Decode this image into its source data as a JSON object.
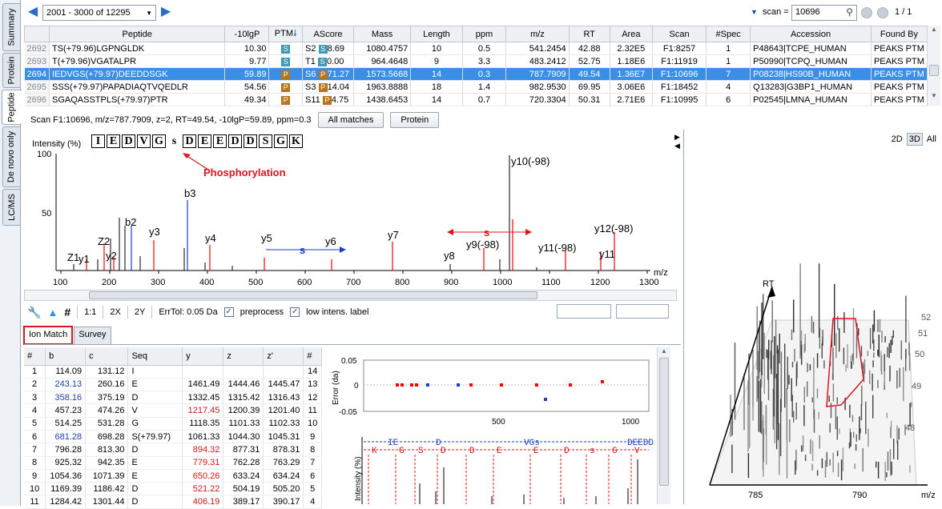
{
  "side_tabs": [
    "Summary",
    "Protein",
    "Peptide",
    "De novo only",
    "LC/MS"
  ],
  "nav": {
    "range": "2001 - 3000 of 12295",
    "scan_label": "scan =",
    "scan_value": "10696",
    "page": "1 / 1"
  },
  "peptide_table": {
    "headers": [
      "Peptide",
      "-10lgP",
      "PTM",
      "AScore",
      "Mass",
      "Length",
      "ppm",
      "m/z",
      "RT",
      "Area",
      "Scan",
      "#Spec",
      "Accession",
      "Found By"
    ],
    "rows": [
      {
        "num": "2692",
        "peptide": "TS(+79.96)LGPNGLDK",
        "lgp": "10.30",
        "ptm": "S",
        "ascore_site": "S2",
        "ascore_badge": "S",
        "ascore": "8.69",
        "mass": "1080.4757",
        "length": "10",
        "ppm": "0.5",
        "mz": "541.2454",
        "rt": "42.88",
        "area": "2.32E5",
        "scan": "F1:8257",
        "spec": "1",
        "accession": "P48643|TCPE_HUMAN",
        "found": "PEAKS PTM"
      },
      {
        "num": "2693",
        "peptide": "T(+79.96)VGATALPR",
        "lgp": "9.77",
        "ptm": "S",
        "ascore_site": "T1",
        "ascore_badge": "S",
        "ascore": "0.00",
        "mass": "964.4648",
        "length": "9",
        "ppm": "3.3",
        "mz": "483.2412",
        "rt": "52.75",
        "area": "1.18E6",
        "scan": "F1:11919",
        "spec": "1",
        "accession": "P50990|TCPQ_HUMAN",
        "found": "PEAKS PTM"
      },
      {
        "num": "2694",
        "peptide": "IEDVGS(+79.97)DEEDDSGK",
        "lgp": "59.89",
        "ptm": "P",
        "ascore_site": "S6",
        "ascore_badge": "P",
        "ascore": "71.27",
        "mass": "1573.5668",
        "length": "14",
        "ppm": "0.3",
        "mz": "787.7909",
        "rt": "49.54",
        "area": "1.36E7",
        "scan": "F1:10696",
        "spec": "7",
        "accession": "P08238|HS90B_HUMAN",
        "found": "PEAKS PTM"
      },
      {
        "num": "2695",
        "peptide": "SSS(+79.97)PAPADIAQTVQEDLR",
        "lgp": "54.56",
        "ptm": "P",
        "ascore_site": "S3",
        "ascore_badge": "P",
        "ascore": "14.04",
        "mass": "1963.8888",
        "length": "18",
        "ppm": "1.4",
        "mz": "982.9530",
        "rt": "69.95",
        "area": "3.06E6",
        "scan": "F1:18452",
        "spec": "4",
        "accession": "Q13283|G3BP1_HUMAN",
        "found": "PEAKS PTM"
      },
      {
        "num": "2696",
        "peptide": "SGAQASSTPLS(+79.97)PTR",
        "lgp": "49.34",
        "ptm": "P",
        "ascore_site": "S11",
        "ascore_badge": "P",
        "ascore": "4.75",
        "mass": "1438.6453",
        "length": "14",
        "ppm": "0.7",
        "mz": "720.3304",
        "rt": "50.31",
        "area": "2.71E6",
        "scan": "F1:10995",
        "spec": "6",
        "accession": "P02545|LMNA_HUMAN",
        "found": "PEAKS PTM"
      }
    ]
  },
  "scan_info": "Scan F1:10696, m/z=787.7909, z=2, RT=49.54, -10lgP=59.89, ppm=0.3",
  "buttons": {
    "all_matches": "All matches",
    "protein": "Protein"
  },
  "spectrum": {
    "ylabel": "Intensity (%)",
    "sequence": [
      "I",
      "E",
      "D",
      "V",
      "G",
      "s",
      "D",
      "E",
      "E",
      "D",
      "D",
      "S",
      "G",
      "K"
    ],
    "annotation": "Phosphorylation",
    "x_ticks": [
      "100",
      "200",
      "300",
      "400",
      "500",
      "600",
      "700",
      "800",
      "900",
      "1000",
      "1100",
      "1200",
      "1300"
    ],
    "x_unit": "m/z",
    "y_ticks": [
      "100",
      "50"
    ],
    "s_label": "s",
    "peak_labels": [
      "Z1",
      "y1",
      "Z2",
      "y2",
      "b2",
      "y3",
      "b3",
      "y4",
      "y5",
      "y6",
      "y7",
      "y8",
      "y9(-98)",
      "y10(-98)",
      "y11(-98)",
      "y12(-98)",
      "y11"
    ]
  },
  "toolbar": {
    "r1": "1:1",
    "r2": "2X",
    "r3": "2Y",
    "errtol": "ErrTol: 0.05 Da",
    "preprocess": "preprocess",
    "low_intens": "low intens. label",
    "hash": "#"
  },
  "ion_tabs": [
    "Ion Match",
    "Survey"
  ],
  "ion_table": {
    "headers": [
      "#",
      "b",
      "c",
      "Seq",
      "y",
      "z",
      "z'",
      "#"
    ],
    "rows": [
      [
        "1",
        "114.09",
        "131.12",
        "I",
        "",
        "",
        "",
        "14"
      ],
      [
        "2",
        "243.13",
        "260.16",
        "E",
        "1461.49",
        "1444.46",
        "1445.47",
        "13"
      ],
      [
        "3",
        "358.16",
        "375.19",
        "D",
        "1332.45",
        "1315.42",
        "1316.43",
        "12"
      ],
      [
        "4",
        "457.23",
        "474.26",
        "V",
        "1217.45",
        "1200.39",
        "1201.40",
        "11"
      ],
      [
        "5",
        "514.25",
        "531.28",
        "G",
        "1118.35",
        "1101.33",
        "1102.33",
        "10"
      ],
      [
        "6",
        "681.28",
        "698.28",
        "S(+79.97)",
        "1061.33",
        "1044.30",
        "1045.31",
        "9"
      ],
      [
        "7",
        "796.28",
        "813.30",
        "D",
        "894.32",
        "877.31",
        "878.31",
        "8"
      ],
      [
        "8",
        "925.32",
        "942.35",
        "E",
        "779.31",
        "762.28",
        "763.29",
        "7"
      ],
      [
        "9",
        "1054.36",
        "1071.39",
        "E",
        "650.26",
        "633.24",
        "634.24",
        "6"
      ],
      [
        "10",
        "1169.39",
        "1186.42",
        "D",
        "521.22",
        "504.19",
        "505.20",
        "5"
      ],
      [
        "11",
        "1284.42",
        "1301.44",
        "D",
        "406.19",
        "389.17",
        "390.17",
        "4"
      ]
    ],
    "blue_b": [
      1,
      2,
      5
    ],
    "red_y": [
      3,
      6,
      7,
      8,
      9,
      10
    ]
  },
  "error_plot": {
    "ylabel": "Error (da)",
    "y_ticks": [
      "0.05",
      "0",
      "-0.05"
    ],
    "x_ticks": [
      "500",
      "1000"
    ],
    "ylabel2": "Intensity (%)"
  },
  "lower_seq": {
    "top": [
      "IE",
      "D",
      "VGs",
      "DEEDD"
    ],
    "bottom": [
      "K",
      "G",
      "S",
      "D",
      "D",
      "E",
      "E",
      "D",
      "s",
      "G",
      "V"
    ]
  },
  "lcms": {
    "view_buttons": [
      "2D",
      "3D",
      "All"
    ],
    "rt_label": "RT",
    "x_ticks": [
      "785",
      "790"
    ],
    "x_unit": "m/z",
    "rt_ticks": [
      "52",
      "51",
      "50",
      "49",
      "48"
    ]
  }
}
